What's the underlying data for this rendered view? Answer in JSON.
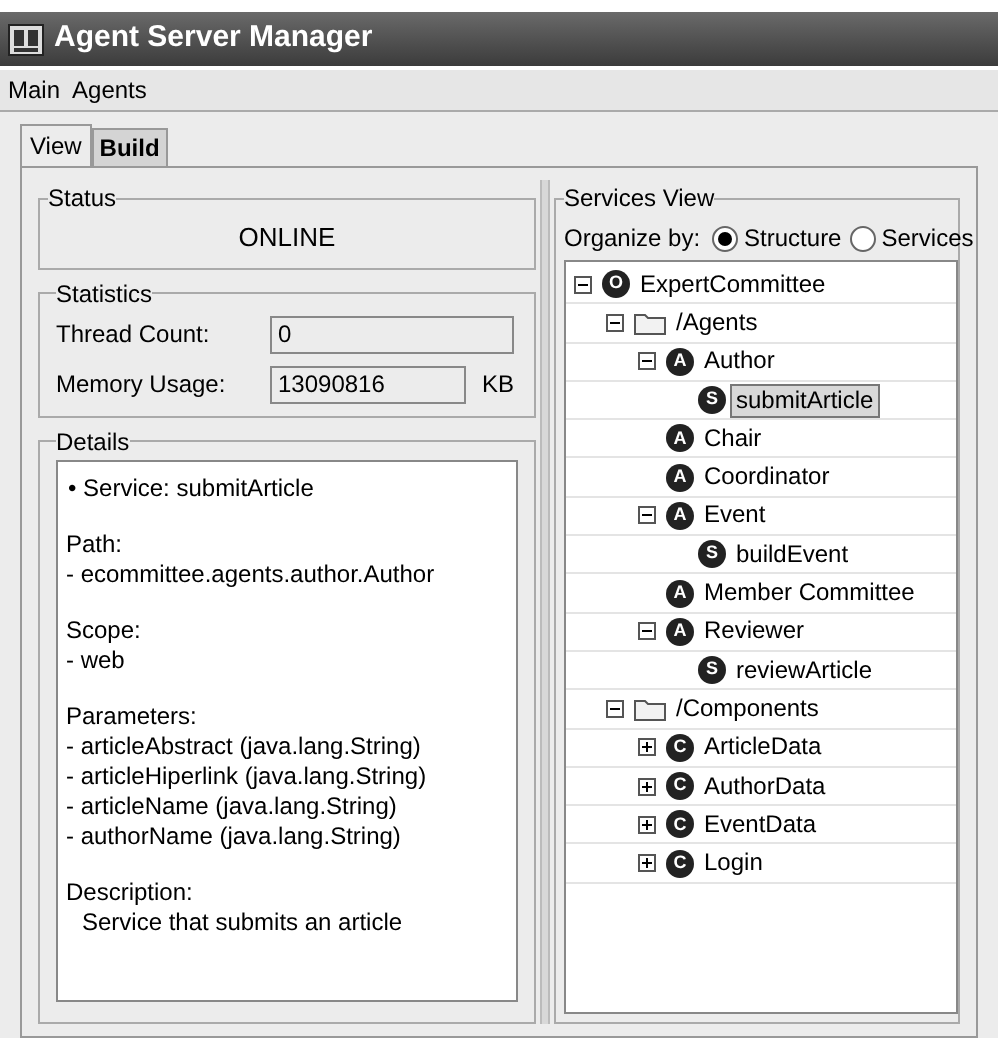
{
  "window": {
    "title": "Agent Server Manager"
  },
  "menu": [
    "Main",
    "Agents"
  ],
  "tabs": [
    {
      "label": "View",
      "selected": true
    },
    {
      "label": "Build",
      "selected": false
    }
  ],
  "status": {
    "title": "Status",
    "value": "ONLINE"
  },
  "statistics": {
    "title": "Statistics",
    "fields": [
      {
        "label": "Thread Count:",
        "value": "0"
      },
      {
        "label": "Memory Usage:",
        "value": "13090816",
        "unit": "KB"
      }
    ]
  },
  "details": {
    "title": "Details",
    "blocks": [
      {
        "kind": "heading",
        "lines": [
          "• Service: submitArticle"
        ]
      },
      {
        "kind": "list",
        "lines": [
          "Path:",
          "- ecommittee.agents.author.Author"
        ]
      },
      {
        "kind": "list",
        "lines": [
          "Scope:",
          "- web"
        ]
      },
      {
        "kind": "list",
        "lines": [
          "Parameters:",
          "- articleAbstract (java.lang.String)",
          "- articleHiperlink (java.lang.String)",
          "- articleName (java.lang.String)",
          "- authorName (java.lang.String)"
        ]
      },
      {
        "kind": "text",
        "lines": [
          "Description:",
          "Service that submits an article"
        ]
      }
    ]
  },
  "services_view": {
    "title": "Services View",
    "organize_label": "Organize by:",
    "options": [
      {
        "label": "Structure",
        "selected": true
      },
      {
        "label": "Services",
        "selected": false
      }
    ],
    "tree": [
      {
        "label": "ExpertCommittee",
        "kind": "badge",
        "badge": "O",
        "expanded": true,
        "selected": false,
        "children": [
          {
            "label": "/Agents",
            "kind": "folder",
            "expanded": true,
            "selected": false,
            "children": [
              {
                "label": "Author",
                "kind": "badge",
                "badge": "A",
                "expanded": true,
                "selected": false,
                "children": [
                  {
                    "label": "submitArticle",
                    "kind": "badge",
                    "badge": "S",
                    "selected": true
                  }
                ]
              },
              {
                "label": "Chair",
                "kind": "badge",
                "badge": "A",
                "selected": false
              },
              {
                "label": "Coordinator",
                "kind": "badge",
                "badge": "A",
                "selected": false
              },
              {
                "label": "Event",
                "kind": "badge",
                "badge": "A",
                "expanded": true,
                "selected": false,
                "children": [
                  {
                    "label": "buildEvent",
                    "kind": "badge",
                    "badge": "S",
                    "selected": false
                  }
                ]
              },
              {
                "label": "Member Committee",
                "kind": "badge",
                "badge": "A",
                "selected": false
              },
              {
                "label": "Reviewer",
                "kind": "badge",
                "badge": "A",
                "expanded": true,
                "selected": false,
                "children": [
                  {
                    "label": "reviewArticle",
                    "kind": "badge",
                    "badge": "S",
                    "selected": false
                  }
                ]
              }
            ]
          },
          {
            "label": "/Components",
            "kind": "folder",
            "expanded": true,
            "selected": false,
            "children": [
              {
                "label": "ArticleData",
                "kind": "badge",
                "badge": "C",
                "expanded": false,
                "selected": false
              },
              {
                "label": "AuthorData",
                "kind": "badge",
                "badge": "C",
                "expanded": false,
                "selected": false
              },
              {
                "label": "EventData",
                "kind": "badge",
                "badge": "C",
                "expanded": false,
                "selected": false
              },
              {
                "label": "Login",
                "kind": "badge",
                "badge": "C",
                "expanded": false,
                "selected": false
              }
            ]
          }
        ]
      }
    ]
  }
}
